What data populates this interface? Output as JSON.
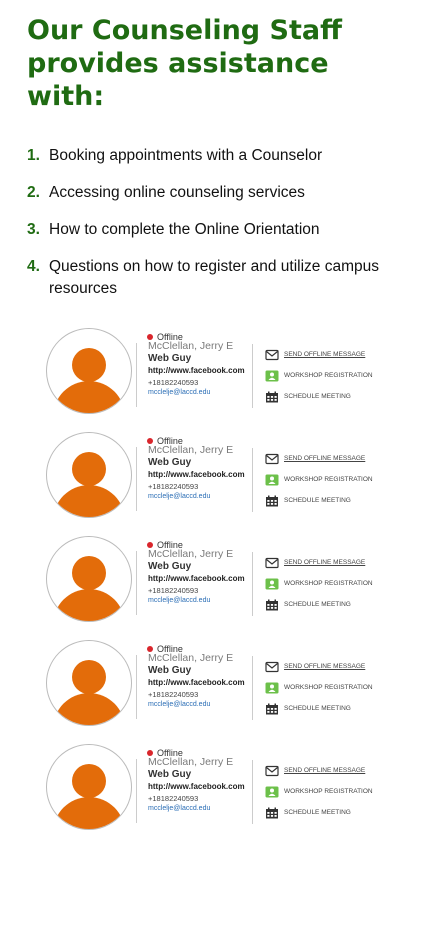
{
  "heading": "Our Counseling Staff provides assistance with:",
  "assistance_items": [
    {
      "num": "1.",
      "text": "Booking appointments with a Counselor"
    },
    {
      "num": "2.",
      "text": "Accessing online counseling services"
    },
    {
      "num": "3.",
      "text": "How to complete the Online Orientation"
    },
    {
      "num": "4.",
      "text": "Questions on how to register and utilize campus resources"
    }
  ],
  "colors": {
    "heading_green": "#1f6b12",
    "avatar_orange": "#e36c0a",
    "offline_red": "#d9262c",
    "email_blue": "#2a6db5"
  },
  "counselors": [
    {
      "status": "Offline",
      "name": "McClellan, Jerry E",
      "title": "Web Guy",
      "url": "http://www.facebook.com",
      "phone": "+18182240593",
      "email": "mcclelje@laccd.edu",
      "actions": {
        "message": "SEND OFFLINE MESSAGE",
        "workshop": "WORKSHOP REGISTRATION",
        "schedule": "SCHEDULE MEETING"
      },
      "icons": {
        "avatar": "user-avatar-icon",
        "message": "envelope-icon",
        "workshop": "workshop-icon",
        "schedule": "calendar-icon"
      }
    },
    {
      "status": "Offline",
      "name": "McClellan, Jerry E",
      "title": "Web Guy",
      "url": "http://www.facebook.com",
      "phone": "+18182240593",
      "email": "mcclelje@laccd.edu",
      "actions": {
        "message": "SEND OFFLINE MESSAGE",
        "workshop": "WORKSHOP REGISTRATION",
        "schedule": "SCHEDULE MEETING"
      },
      "icons": {
        "avatar": "user-avatar-icon",
        "message": "envelope-icon",
        "workshop": "workshop-icon",
        "schedule": "calendar-icon"
      }
    },
    {
      "status": "Offline",
      "name": "McClellan, Jerry E",
      "title": "Web Guy",
      "url": "http://www.facebook.com",
      "phone": "+18182240593",
      "email": "mcclelje@laccd.edu",
      "actions": {
        "message": "SEND OFFLINE MESSAGE",
        "workshop": "WORKSHOP REGISTRATION",
        "schedule": "SCHEDULE MEETING"
      },
      "icons": {
        "avatar": "user-avatar-icon",
        "message": "envelope-icon",
        "workshop": "workshop-icon",
        "schedule": "calendar-icon"
      }
    },
    {
      "status": "Offline",
      "name": "McClellan, Jerry E",
      "title": "Web Guy",
      "url": "http://www.facebook.com",
      "phone": "+18182240593",
      "email": "mcclelje@laccd.edu",
      "actions": {
        "message": "SEND OFFLINE MESSAGE",
        "workshop": "WORKSHOP REGISTRATION",
        "schedule": "SCHEDULE MEETING"
      },
      "icons": {
        "avatar": "user-avatar-icon",
        "message": "envelope-icon",
        "workshop": "workshop-icon",
        "schedule": "calendar-icon"
      }
    },
    {
      "status": "Offline",
      "name": "McClellan, Jerry E",
      "title": "Web Guy",
      "url": "http://www.facebook.com",
      "phone": "+18182240593",
      "email": "mcclelje@laccd.edu",
      "actions": {
        "message": "SEND OFFLINE MESSAGE",
        "workshop": "WORKSHOP REGISTRATION",
        "schedule": "SCHEDULE MEETING"
      },
      "icons": {
        "avatar": "user-avatar-icon",
        "message": "envelope-icon",
        "workshop": "workshop-icon",
        "schedule": "calendar-icon"
      }
    }
  ]
}
